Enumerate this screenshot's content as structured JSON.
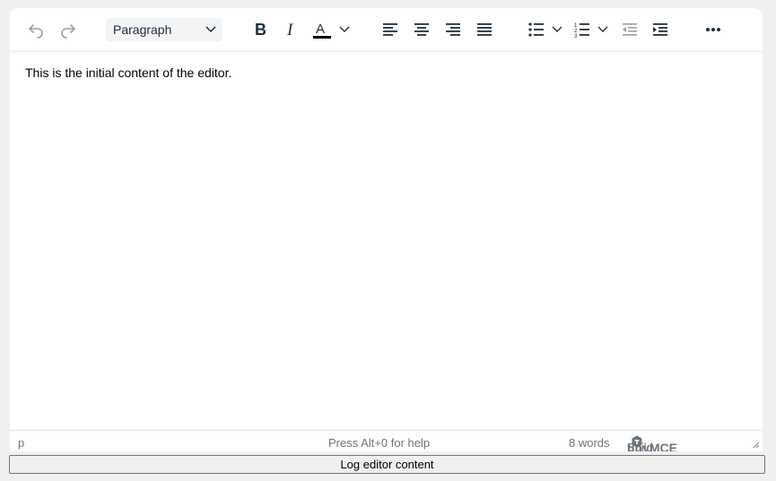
{
  "toolbar": {
    "block_format": "Paragraph",
    "buttons": {
      "undo": "undo-icon",
      "redo": "redo-icon",
      "bold": "bold-icon",
      "italic": "italic-icon",
      "text_color": "text-color-icon",
      "align_left": "align-left-icon",
      "align_center": "align-center-icon",
      "align_right": "align-right-icon",
      "justify": "align-justify-icon",
      "bullet_list": "bullet-list-icon",
      "numbered_list": "numbered-list-icon",
      "outdent": "outdent-icon",
      "indent": "indent-icon",
      "more": "more-icon"
    },
    "text_color_swatch": "#000000"
  },
  "content": {
    "paragraph": "This is the initial content of the editor."
  },
  "statusbar": {
    "path": "p",
    "help": "Press Alt+0 for help",
    "word_count": "8 words",
    "build_with": "Build with",
    "brand": "tinyMCE"
  },
  "log_button": "Log editor content"
}
